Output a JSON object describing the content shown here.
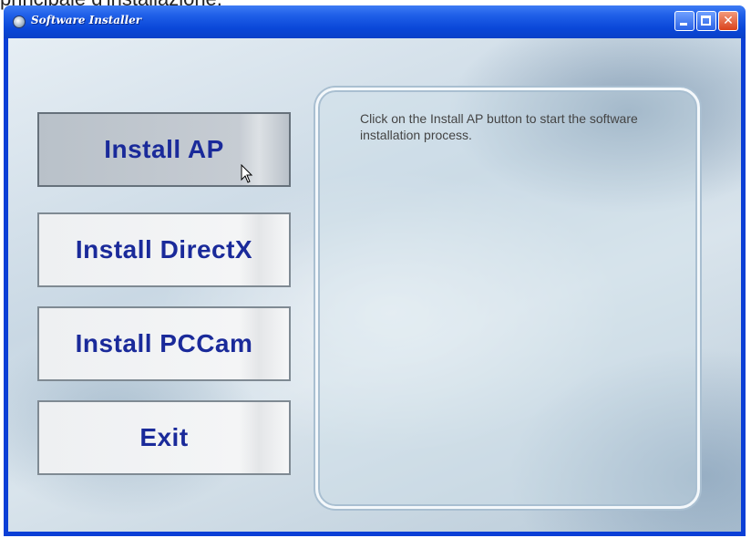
{
  "caption": "principale d'installazione.",
  "window": {
    "title": "Software Installer"
  },
  "buttons": {
    "install_ap": "Install AP",
    "install_directx": "Install DirectX",
    "install_pccam": "Install PCCam",
    "exit": "Exit"
  },
  "info": {
    "text": "Click on the Install AP button to start the software installation process."
  },
  "icons": {
    "app": "app-icon",
    "cursor": "mouse-pointer-icon"
  },
  "colors": {
    "titlebar": "#0a47d8",
    "button_text": "#1a2a9a",
    "close": "#d9421c"
  }
}
